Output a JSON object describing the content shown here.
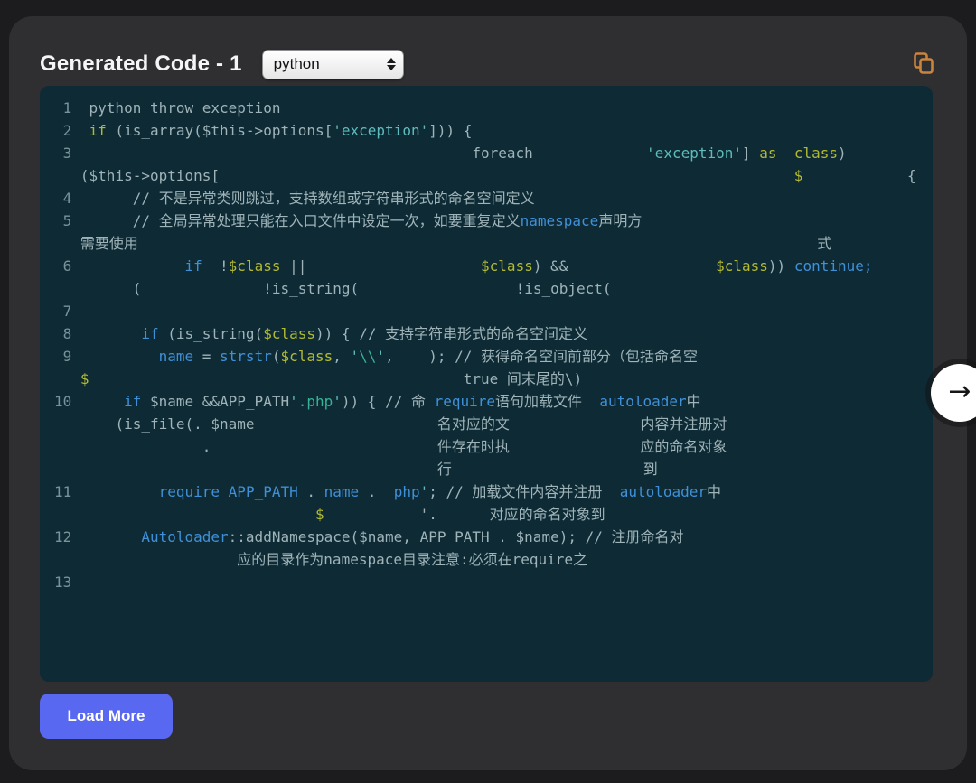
{
  "header": {
    "title": "Generated Code - 1",
    "language_select": {
      "value": "python"
    }
  },
  "icons": {
    "copy": "copy-icon",
    "select_arrows": "up-down-arrows-icon",
    "next": "arrow-right-icon"
  },
  "colors": {
    "card_bg": "#2f2f32",
    "page_bg": "#1c1c1e",
    "code_bg": "#0d2a35",
    "accent_button": "#5968f0",
    "copy_icon": "#c9843d",
    "token_default": "#9fb3b8",
    "token_keyword_blue": "#4090d8",
    "token_yellow": "#b3ba32",
    "token_string_cyan": "#5fbcbc",
    "token_teal": "#36b295",
    "line_number": "#7a939b"
  },
  "footer": {
    "load_more_label": "Load More"
  },
  "nav": {
    "next_arrow": "→"
  },
  "code": {
    "rows": [
      [
        [
          "ln",
          " 1  "
        ],
        [
          "d",
          "python throw exception"
        ]
      ],
      [
        [
          "ln",
          " 2  "
        ],
        [
          "y",
          "if"
        ],
        [
          "d",
          " (is_array($this->options["
        ],
        [
          "s",
          "'exception'"
        ],
        [
          "d",
          "])) {"
        ]
      ],
      [
        [
          "ln",
          " 3  "
        ],
        [
          "sp",
          44
        ],
        [
          "d",
          "foreach"
        ],
        [
          "sp",
          13
        ],
        [
          "s",
          "'exception'"
        ],
        [
          "d",
          "] "
        ],
        [
          "y",
          "as"
        ],
        [
          "sp",
          2
        ],
        [
          "y",
          "class"
        ],
        [
          "d",
          ")"
        ]
      ],
      [
        [
          "sp",
          3
        ],
        [
          "d",
          "($this->options["
        ],
        [
          "sp",
          66
        ],
        [
          "y",
          "$"
        ],
        [
          "sp",
          12
        ],
        [
          "d",
          "{"
        ]
      ],
      [
        [
          "ln",
          " 4  "
        ],
        [
          "sp",
          5
        ],
        [
          "d",
          "// 不是异常类则跳过，支持数组或字符串形式的命名空间定义"
        ]
      ],
      [
        [
          "ln",
          " 5  "
        ],
        [
          "sp",
          5
        ],
        [
          "d",
          "// 全局异常处理只能在入口文件中设定一次，如要重复定义"
        ],
        [
          "b",
          "namespace"
        ],
        [
          "d",
          "声明方"
        ]
      ],
      [
        [
          "sp",
          3
        ],
        [
          "d",
          "需要使用"
        ],
        [
          "sp",
          78
        ],
        [
          "d",
          "式"
        ]
      ],
      [
        [
          "ln",
          " 6  "
        ],
        [
          "sp",
          11
        ],
        [
          "b",
          "if"
        ],
        [
          "d",
          "  !"
        ],
        [
          "y",
          "$class"
        ],
        [
          "d",
          " ||"
        ],
        [
          "sp",
          20
        ],
        [
          "y",
          "$class"
        ],
        [
          "d",
          ") &&"
        ],
        [
          "sp",
          17
        ],
        [
          "y",
          "$class"
        ],
        [
          "d",
          ")) "
        ],
        [
          "b",
          "continue;"
        ]
      ],
      [
        [
          "sp",
          9
        ],
        [
          "d",
          "("
        ],
        [
          "sp",
          14
        ],
        [
          "d",
          "!is_string("
        ],
        [
          "sp",
          18
        ],
        [
          "d",
          "!is_object("
        ]
      ],
      [
        [
          "ln",
          " 7  "
        ]
      ],
      [
        [
          "ln",
          " 8  "
        ],
        [
          "sp",
          6
        ],
        [
          "b",
          "if"
        ],
        [
          "d",
          " (is_string("
        ],
        [
          "y",
          "$class"
        ],
        [
          "d",
          ")) { // 支持字符串形式的命名空间定义"
        ]
      ],
      [
        [
          "ln",
          " 9  "
        ],
        [
          "sp",
          8
        ],
        [
          "b",
          "name"
        ],
        [
          "d",
          " = "
        ],
        [
          "b",
          "strstr"
        ],
        [
          "d",
          "("
        ],
        [
          "y",
          "$class"
        ],
        [
          "d",
          ", "
        ],
        [
          "s",
          "'"
        ],
        [
          "t",
          "\\\\"
        ],
        [
          "s",
          "'"
        ],
        [
          "d",
          ",    ); // 获得命名空间前部分（包括命名空"
        ]
      ],
      [
        [
          "sp",
          3
        ],
        [
          "y",
          "$"
        ],
        [
          "sp",
          43
        ],
        [
          "d",
          "true 间末尾的\\)"
        ]
      ],
      [
        [
          "ln",
          "10  "
        ],
        [
          "sp",
          4
        ],
        [
          "b",
          "if"
        ],
        [
          "d",
          " $name &&APP_PATH"
        ],
        [
          "s",
          "'"
        ],
        [
          "t",
          ".php"
        ],
        [
          "s",
          "'"
        ],
        [
          "d",
          ")) { // 命 "
        ],
        [
          "b",
          "require"
        ],
        [
          "d",
          "语句加载文件  "
        ],
        [
          "b",
          "autoloader"
        ],
        [
          "d",
          "中"
        ]
      ],
      [
        [
          "sp",
          7
        ],
        [
          "d",
          "(is_file(. $name"
        ],
        [
          "sp",
          21
        ],
        [
          "d",
          "名对应的文"
        ],
        [
          "sp",
          15
        ],
        [
          "d",
          "内容并注册对"
        ]
      ],
      [
        [
          "sp",
          17
        ],
        [
          "d",
          "."
        ],
        [
          "sp",
          26
        ],
        [
          "d",
          "件存在时执"
        ],
        [
          "sp",
          15
        ],
        [
          "d",
          "应的命名对象"
        ]
      ],
      [
        [
          "sp",
          44
        ],
        [
          "d",
          "行"
        ],
        [
          "sp",
          22
        ],
        [
          "d",
          "到"
        ]
      ],
      [
        [
          "ln",
          "11  "
        ],
        [
          "sp",
          8
        ],
        [
          "b",
          "require"
        ],
        [
          "d",
          " "
        ],
        [
          "b",
          "APP_PATH"
        ],
        [
          "d",
          " . "
        ],
        [
          "b",
          "name"
        ],
        [
          "d",
          " .  "
        ],
        [
          "b",
          "php"
        ],
        [
          "s",
          "'"
        ],
        [
          "d",
          "; // 加载文件内容并注册  "
        ],
        [
          "b",
          "autoloader"
        ],
        [
          "d",
          "中"
        ]
      ],
      [
        [
          "sp",
          30
        ],
        [
          "y",
          "$"
        ],
        [
          "sp",
          11
        ],
        [
          "d",
          "'."
        ],
        [
          "sp",
          6
        ],
        [
          "d",
          "对应的命名对象到"
        ]
      ],
      [
        [
          "ln",
          "12  "
        ],
        [
          "sp",
          6
        ],
        [
          "b",
          "Autoloader"
        ],
        [
          "d",
          "::addNamespace($name, APP_PATH . $name); // 注册命名对"
        ]
      ],
      [
        [
          "sp",
          21
        ],
        [
          "d",
          "应的目录作为namespace目录注意:必须在require之"
        ]
      ],
      [
        [
          "ln",
          "13  "
        ]
      ]
    ]
  }
}
